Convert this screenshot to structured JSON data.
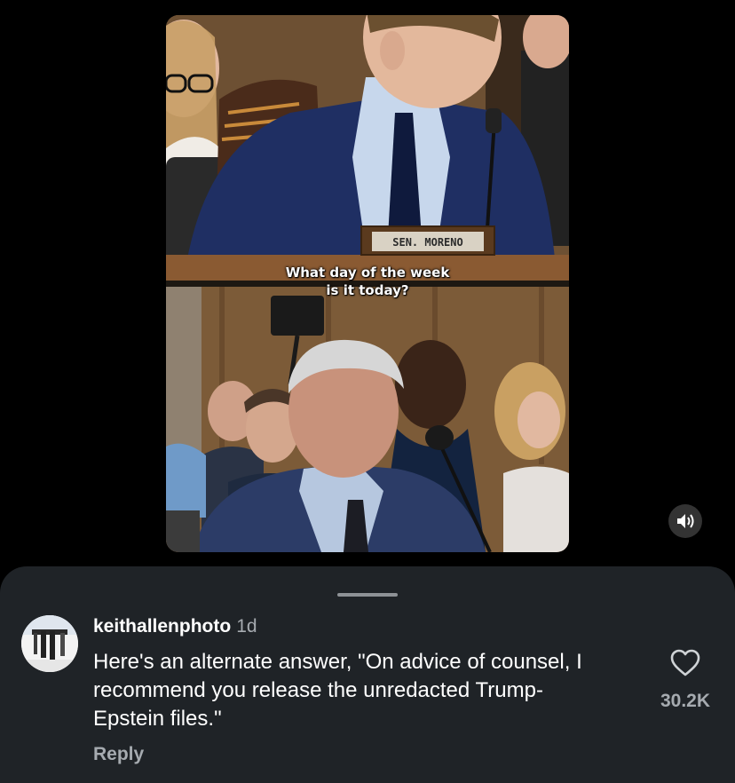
{
  "video": {
    "subtitle_line1": "What day of the week",
    "subtitle_line2": "is it today?",
    "nameplate": "SEN. MORENO",
    "sound_icon": "speaker-on-icon"
  },
  "comment": {
    "username": "keithallenphoto",
    "time": "1d",
    "text": "Here's an alternate answer, \"On advice of counsel, I recommend you release the unredacted Trump-Epstein files.\"",
    "reply_label": "Reply",
    "like_icon": "heart-outline-icon",
    "like_count": "30.2K"
  },
  "colors": {
    "sheet_bg": "#1f2327",
    "secondary_text": "#a6abb0",
    "page_bg": "#000000"
  }
}
